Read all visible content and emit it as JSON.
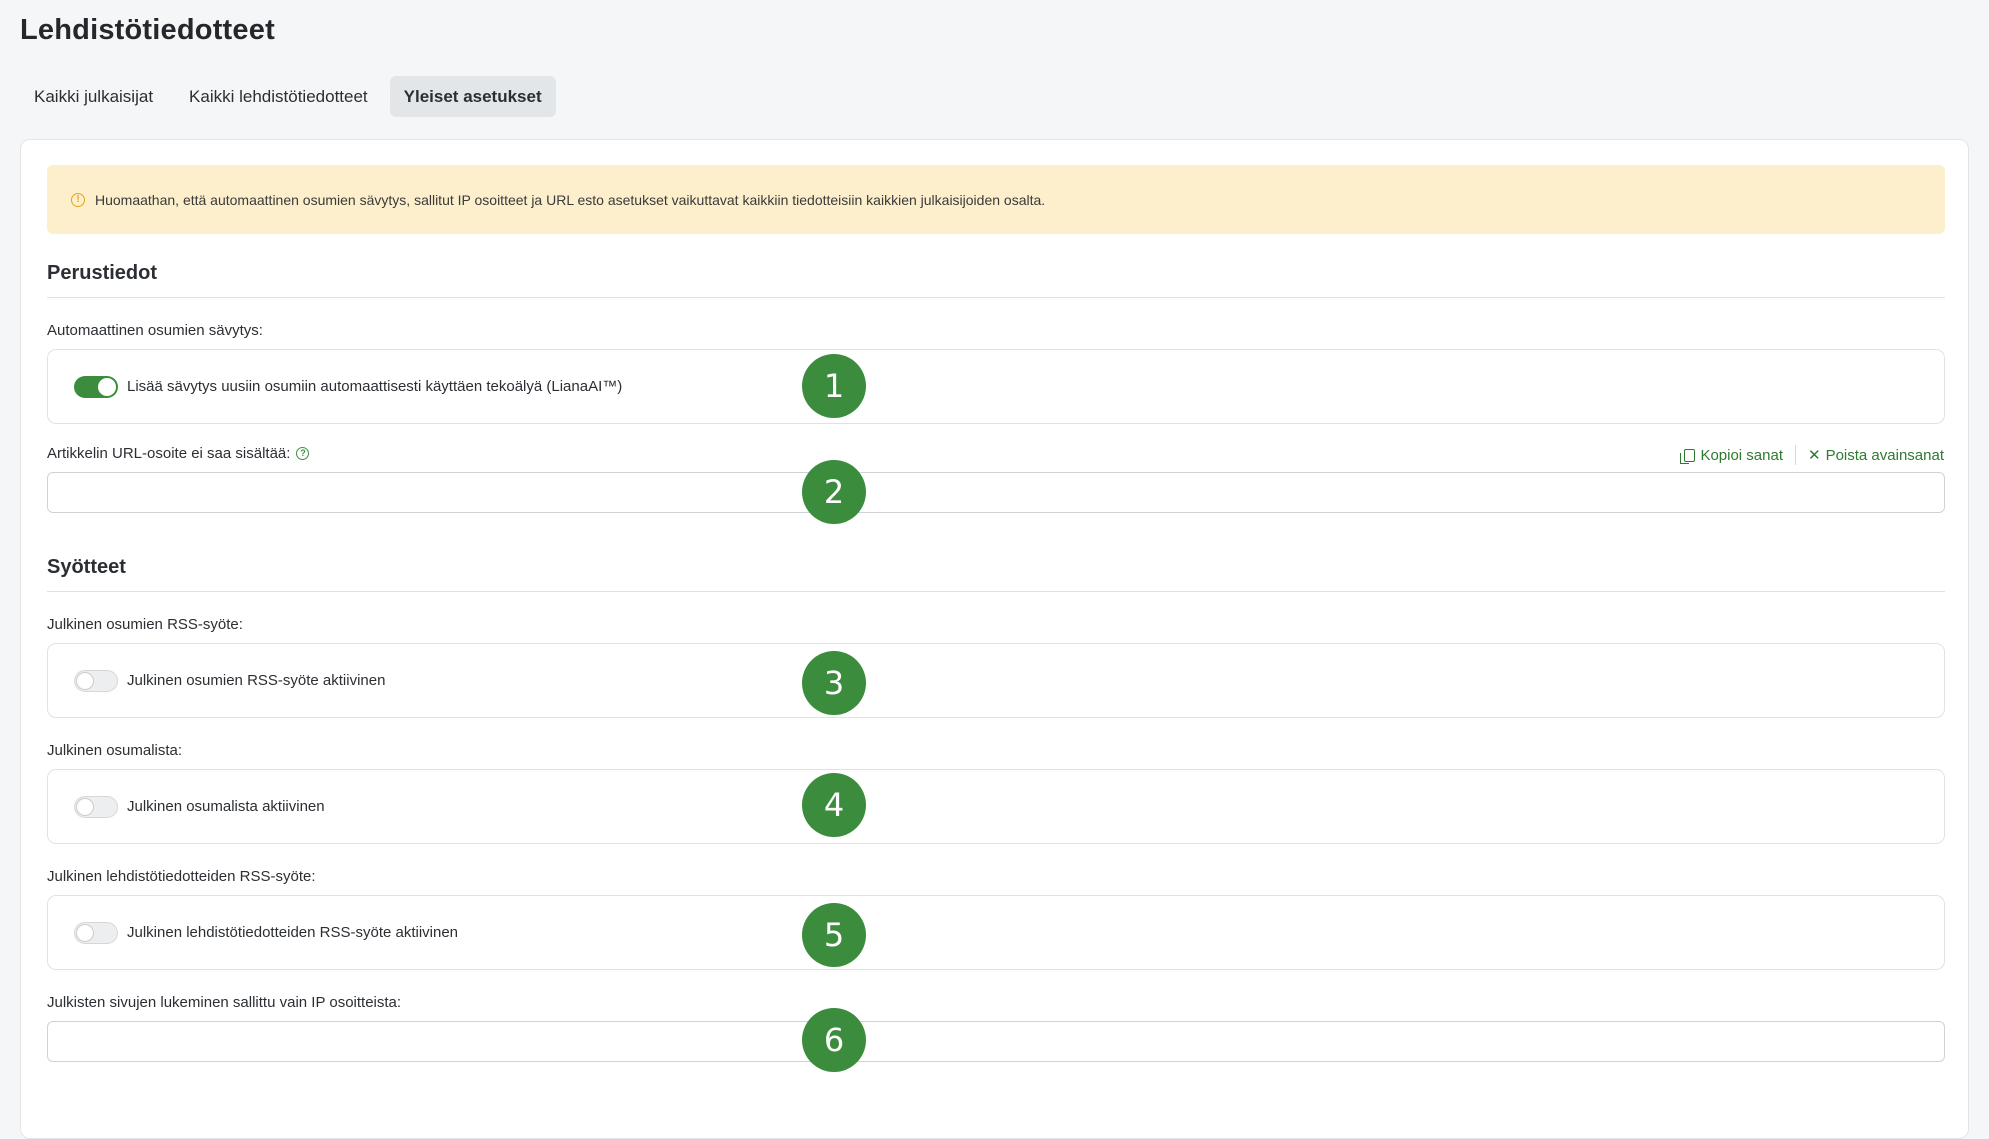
{
  "page": {
    "title": "Lehdistötiedotteet"
  },
  "tabs": [
    {
      "label": "Kaikki julkaisijat",
      "active": false
    },
    {
      "label": "Kaikki lehdistötiedotteet",
      "active": false
    },
    {
      "label": "Yleiset asetukset",
      "active": true
    }
  ],
  "notice": {
    "icon": "warning-icon",
    "text": "Huomaathan, että automaattinen osumien sävytys, sallitut IP osoitteet ja URL esto asetukset vaikuttavat kaikkiin tiedotteisiin kaikkien julkaisijoiden osalta."
  },
  "basic": {
    "title": "Perustiedot",
    "auto_tone": {
      "label": "Automaattinen osumien sävytys:",
      "toggle_label": "Lisää sävytys uusiin osumiin automaattisesti käyttäen tekoälyä (LianaAI™)",
      "enabled": true
    },
    "url_block": {
      "label": "Artikkelin URL-osoite ei saa sisältää:",
      "value": "",
      "copy_label": "Kopioi sanat",
      "remove_label": "Poista avainsanat"
    }
  },
  "feeds": {
    "title": "Syötteet",
    "rss_hits": {
      "label": "Julkinen osumien RSS-syöte:",
      "toggle_label": "Julkinen osumien RSS-syöte aktiivinen",
      "enabled": false
    },
    "hit_list": {
      "label": "Julkinen osumalista:",
      "toggle_label": "Julkinen osumalista aktiivinen",
      "enabled": false
    },
    "rss_releases": {
      "label": "Julkinen lehdistötiedotteiden RSS-syöte:",
      "toggle_label": "Julkinen lehdistötiedotteiden RSS-syöte aktiivinen",
      "enabled": false
    },
    "ip_allow": {
      "label": "Julkisten sivujen lukeminen sallittu vain IP osoitteista:",
      "value": ""
    }
  },
  "badges": [
    "1",
    "2",
    "3",
    "4",
    "5",
    "6"
  ],
  "colors": {
    "accent": "#3b8d3d",
    "notice_bg": "#fdefcb",
    "warning": "#e7a21b"
  }
}
